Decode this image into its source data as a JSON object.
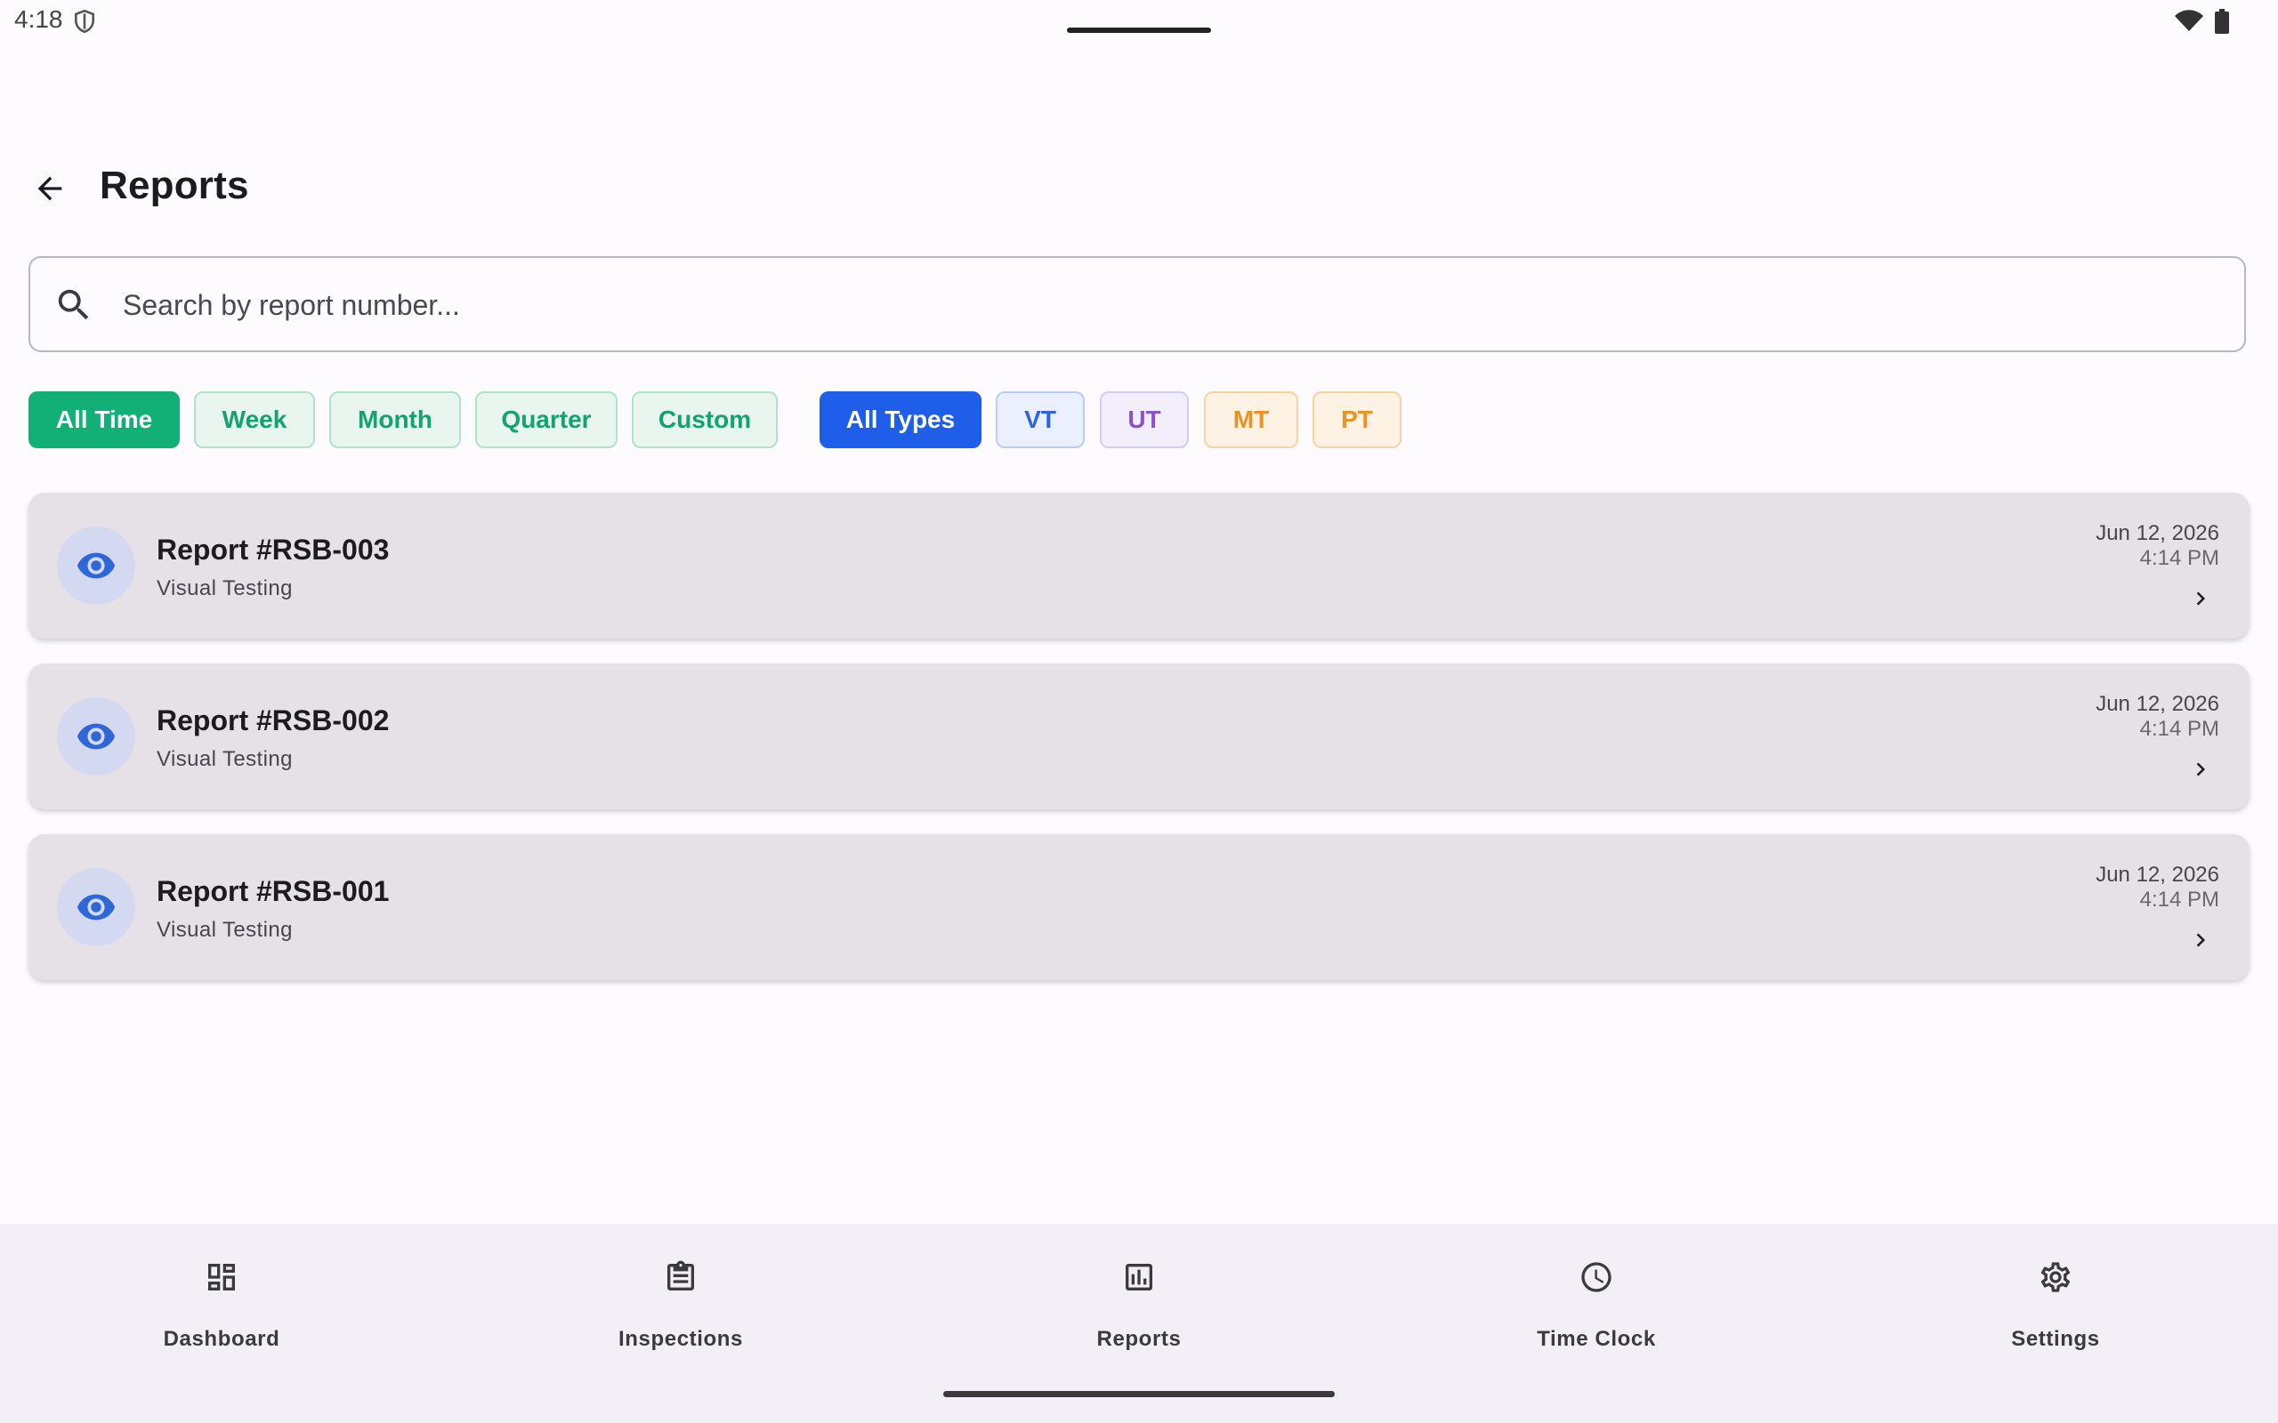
{
  "status_bar": {
    "time": "4:18"
  },
  "app_bar": {
    "title": "Reports"
  },
  "search": {
    "placeholder": "Search by report number...",
    "value": ""
  },
  "filters": {
    "time_ranges": [
      "All Time",
      "Week",
      "Month",
      "Quarter",
      "Custom"
    ],
    "selected_time_range": "All Time",
    "types": [
      "All Types",
      "VT",
      "UT",
      "MT",
      "PT"
    ],
    "selected_type": "All Types"
  },
  "reports": [
    {
      "title": "Report #RSB-003",
      "type": "Visual Testing",
      "date": "Jun 12, 2026",
      "time": "4:14 PM"
    },
    {
      "title": "Report #RSB-002",
      "type": "Visual Testing",
      "date": "Jun 12, 2026",
      "time": "4:14 PM"
    },
    {
      "title": "Report #RSB-001",
      "type": "Visual Testing",
      "date": "Jun 12, 2026",
      "time": "4:14 PM"
    }
  ],
  "bottom_nav": {
    "items": [
      {
        "label": "Dashboard",
        "icon": "dashboard-icon"
      },
      {
        "label": "Inspections",
        "icon": "clipboard-icon"
      },
      {
        "label": "Reports",
        "icon": "bar-chart-icon"
      },
      {
        "label": "Time Clock",
        "icon": "clock-icon"
      },
      {
        "label": "Settings",
        "icon": "gear-icon"
      }
    ]
  },
  "colors": {
    "time_filter_selected": "#12b076",
    "type_filter_selected": "#1f5ee8",
    "vt": "#2f67d8",
    "ut": "#8a54d0",
    "mt": "#ea9324",
    "pt": "#ea9324",
    "card_background": "#e6e1e6",
    "report_icon": "#2f67d8"
  }
}
